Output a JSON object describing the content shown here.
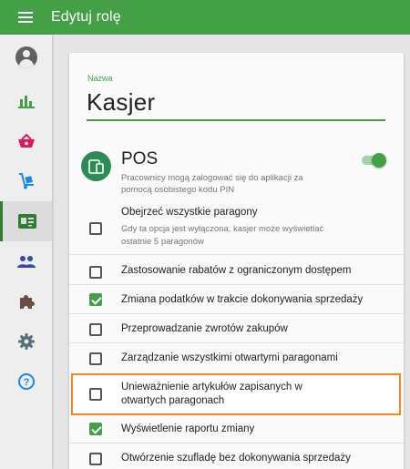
{
  "topbar": {
    "title": "Edytuj rolę",
    "menu_icon": "menu-icon"
  },
  "sidebar": {
    "items": [
      {
        "name": "reports",
        "icon": "bar-chart-icon",
        "color": "#43a047"
      },
      {
        "name": "shop",
        "icon": "basket-icon",
        "color": "#d81b60"
      },
      {
        "name": "delivery",
        "icon": "hand-truck-icon",
        "color": "#1e88e5"
      },
      {
        "name": "employees",
        "icon": "id-card-icon",
        "color": "#2e7d32",
        "active": true
      },
      {
        "name": "customers",
        "icon": "people-icon",
        "color": "#3949ab"
      },
      {
        "name": "integrations",
        "icon": "puzzle-icon",
        "color": "#6d4c41"
      },
      {
        "name": "settings",
        "icon": "gear-icon",
        "color": "#546e7a"
      },
      {
        "name": "help",
        "icon": "help-icon",
        "color": "#1e88e5"
      }
    ]
  },
  "form": {
    "name_label": "Nazwa",
    "name_value": "Kasjer"
  },
  "pos": {
    "title": "POS",
    "description": "Pracownicy mogą zalogować się do aplikacji za pomocą osobistego kodu PIN",
    "enabled": true
  },
  "options": [
    {
      "label": "Obejrzeć wszystkie paragony",
      "sub": "Gdy ta opcja jest wyłączona, kasjer może wyświetlać ostatnie 5 paragonów",
      "checked": false
    },
    {
      "label": "Zastosowanie rabatów z ograniczonym dostępem",
      "checked": false
    },
    {
      "label": "Zmiana podatków w trakcie dokonywania sprzedaży",
      "checked": true
    },
    {
      "label": "Przeprowadzanie zwrotów zakupów",
      "checked": false
    },
    {
      "label": "Zarządzanie wszystkimi otwartymi paragonami",
      "checked": false
    },
    {
      "label": "Unieważnienie artykułów zapisanych w otwartych paragonach",
      "checked": false,
      "highlighted": true
    },
    {
      "label": "Wyświetlenie raportu zmiany",
      "checked": true
    },
    {
      "label": "Otwórzenie szufladę bez dokonywania sprzedaży",
      "checked": false
    }
  ],
  "colors": {
    "accent": "#43a047",
    "highlight_border": "#f08a24"
  }
}
